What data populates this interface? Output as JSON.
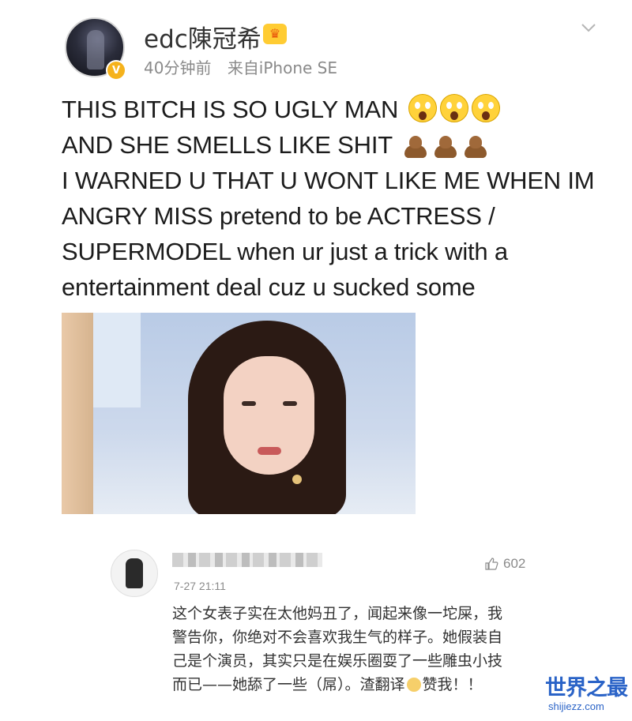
{
  "post": {
    "username": "edc陳冠希",
    "time": "40分钟前",
    "source": "来自iPhone SE",
    "lines": [
      "THIS BITCH IS SO UGLY MAN",
      "AND SHE SMELLS LIKE SHIT",
      "I WARNED U THAT U WONT LIKE ME WHEN IM",
      "ANGRY MISS pretend to be ACTRESS /",
      "SUPERMODEL when ur just a trick with a",
      "entertainment deal cuz u sucked some"
    ],
    "line1_emojis": [
      "scream-emoji",
      "scream-emoji",
      "scream-emoji"
    ],
    "line2_emojis": [
      "poo-emoji",
      "poo-emoji",
      "poo-emoji"
    ]
  },
  "comment": {
    "time": "7-27 21:11",
    "likes": "602",
    "text_before": "这个女表子实在太他妈丑了，闻起来像一坨屎，我警告你，你绝对不会喜欢我生气的样子。她假装自己是个演员，其实只是在娱乐圈耍了一些雕虫小技而已——她舔了一些（屌）。渣翻译",
    "text_after": "赞我！！"
  },
  "watermark": {
    "title": "世界之最",
    "url": "shijiezz.com"
  },
  "colors": {
    "verified": "#f5b21c",
    "watermark": "#2a63c7",
    "meta_text": "#8a8a8a"
  }
}
